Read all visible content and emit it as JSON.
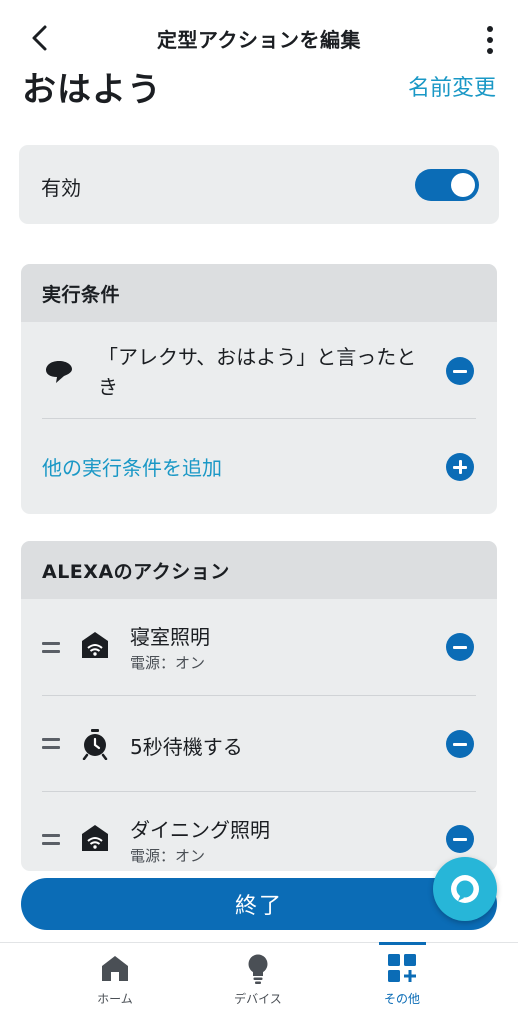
{
  "header": {
    "title": "定型アクションを編集",
    "routine_name": "おはよう",
    "rename_label": "名前変更"
  },
  "enabled": {
    "label": "有効",
    "is_on": true
  },
  "trigger_section": {
    "title": "実行条件",
    "trigger_text": "「アレクサ、おはよう」と言ったとき",
    "add_label": "他の実行条件を追加"
  },
  "actions_section": {
    "title": "ALEXAのアクション",
    "items": [
      {
        "title": "寝室照明",
        "subtitle": "電源：オン",
        "icon": "smart-home-icon"
      },
      {
        "title": "5秒待機する",
        "subtitle": "",
        "icon": "alarm-clock-icon"
      },
      {
        "title": "ダイニング照明",
        "subtitle": "電源：オン",
        "icon": "smart-home-icon"
      }
    ]
  },
  "done_label": "終了",
  "bottom_nav": {
    "items": [
      {
        "label": "ホーム",
        "icon": "home-icon"
      },
      {
        "label": "デバイス",
        "icon": "lightbulb-icon"
      },
      {
        "label": "その他",
        "icon": "more-grid-icon",
        "active": true
      }
    ]
  },
  "colors": {
    "accent": "#0b6cb6",
    "link": "#1a98c6",
    "alexa": "#27b6d8",
    "card_bg": "#ebedee",
    "card_header_bg": "#dcdee0"
  }
}
